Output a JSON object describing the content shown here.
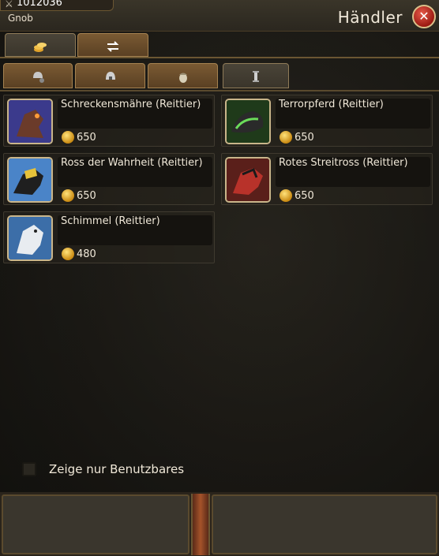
{
  "window": {
    "gold": "1012036",
    "player_name": "Gnob",
    "title": "Händler"
  },
  "tabs_top": [
    {
      "icon": "coins-icon"
    },
    {
      "icon": "swap-arrows-icon"
    }
  ],
  "tabs_sub": [
    {
      "icon": "helmet-gear-icon"
    },
    {
      "icon": "helmet-icon"
    },
    {
      "icon": "acorn-icon"
    },
    {
      "icon": "scroll-icon"
    }
  ],
  "items": [
    {
      "name": "Schreckensmähre (Reittier)",
      "price": "650",
      "icon": "nightmare-mount-icon"
    },
    {
      "name": "Terrorpferd (Reittier)",
      "price": "650",
      "icon": "terror-horse-icon"
    },
    {
      "name": "Ross der Wahrheit (Reittier)",
      "price": "650",
      "icon": "golden-horse-icon"
    },
    {
      "name": "Rotes Streitross (Reittier)",
      "price": "650",
      "icon": "red-warhorse-icon"
    },
    {
      "name": "Schimmel (Reittier)",
      "price": "480",
      "icon": "white-horse-icon"
    }
  ],
  "filter": {
    "label": "Zeige nur Benutzbares",
    "checked": false
  },
  "colors": {
    "accent": "#c9b58a",
    "close": "#c0392b",
    "gold_coin": "#e0a22a"
  }
}
